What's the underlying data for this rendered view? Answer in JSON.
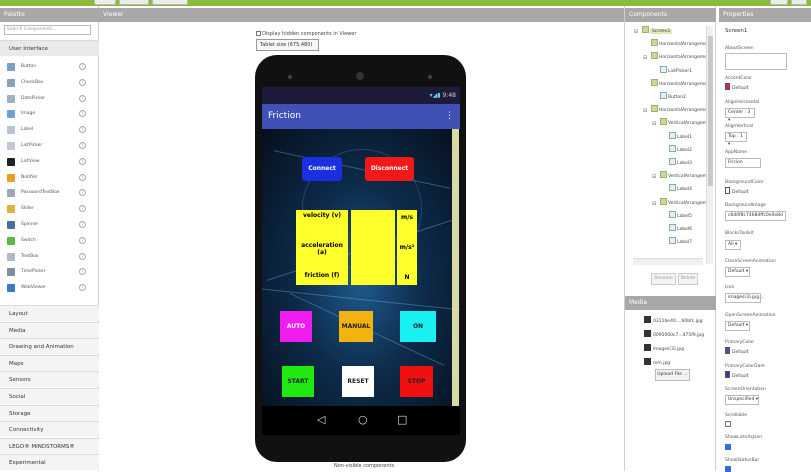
{
  "palette": {
    "title": "Palette",
    "search_placeholder": "Search Components...",
    "user_interface_label": "User Interface",
    "items": [
      {
        "label": "Button",
        "icon": "button-icon",
        "color": "#7a9fc8"
      },
      {
        "label": "CheckBox",
        "icon": "checkbox-icon",
        "color": "#8aa0b8"
      },
      {
        "label": "DatePicker",
        "icon": "datepicker-icon",
        "color": "#9db0c6"
      },
      {
        "label": "Image",
        "icon": "image-icon",
        "color": "#6ea0d0"
      },
      {
        "label": "Label",
        "icon": "label-icon",
        "color": "#b8c4d4"
      },
      {
        "label": "ListPicker",
        "icon": "listpicker-icon",
        "color": "#c0c8d4"
      },
      {
        "label": "ListView",
        "icon": "listview-icon",
        "color": "#222222"
      },
      {
        "label": "Notifier",
        "icon": "notifier-icon",
        "color": "#e8a020"
      },
      {
        "label": "PasswordTextBox",
        "icon": "password-icon",
        "color": "#9aa8b8"
      },
      {
        "label": "Slider",
        "icon": "slider-icon",
        "color": "#e0b040"
      },
      {
        "label": "Spinner",
        "icon": "spinner-icon",
        "color": "#4a6fa0"
      },
      {
        "label": "Switch",
        "icon": "switch-icon",
        "color": "#58b848"
      },
      {
        "label": "TextBox",
        "icon": "textbox-icon",
        "color": "#b0b8c4"
      },
      {
        "label": "TimePicker",
        "icon": "timepicker-icon",
        "color": "#8090a4"
      },
      {
        "label": "WebViewer",
        "icon": "webviewer-icon",
        "color": "#3a78c8"
      }
    ],
    "categories": [
      "Layout",
      "Media",
      "Drawing and Animation",
      "Maps",
      "Sensors",
      "Social",
      "Storage",
      "Connectivity",
      "LEGO® MINDSTORMS®",
      "Experimental"
    ]
  },
  "viewer": {
    "title": "Viewer",
    "hidden_checkbox_label": "Display hidden components in Viewer",
    "size_select": "Tablet size (675,480)",
    "status_time": "9:48",
    "app_title": "Friction",
    "menu_glyph": "⋮",
    "buttons": {
      "connect": "Connect",
      "disconnect": "Disconnect",
      "auto": "AUTO",
      "manual": "MANUAL",
      "on": "ON",
      "start": "START",
      "reset": "RESET",
      "stop": "STOP"
    },
    "labels": {
      "velocity": "velocity (v)",
      "acceleration": "acceleration (a)",
      "friction": "friction (f)",
      "unit_v": "m/s",
      "unit_a": "m/s²",
      "unit_f": "N"
    },
    "nav": {
      "back": "◁",
      "home": "○",
      "recent": "□"
    },
    "non_visible": "Non-visible components"
  },
  "components": {
    "title": "Components",
    "tree": [
      {
        "label": "Screen1",
        "level": 0,
        "expander": "⊟",
        "icon": "screen-icon"
      },
      {
        "label": "HorizontalArrangeme",
        "level": 1,
        "expander": "",
        "icon": "arrangement-icon"
      },
      {
        "label": "HorizontalArrangeme",
        "level": 1,
        "expander": "⊟",
        "icon": "arrangement-icon"
      },
      {
        "label": "ListPicker1",
        "level": 2,
        "expander": "",
        "icon": "listpicker-icon"
      },
      {
        "label": "HorizontalArrangeme",
        "level": 1,
        "expander": "",
        "icon": "arrangement-icon"
      },
      {
        "label": "Button2",
        "level": 2,
        "expander": "",
        "icon": "button-icon"
      },
      {
        "label": "HorizontalArrangeme",
        "level": 1,
        "expander": "⊟",
        "icon": "arrangement-icon"
      },
      {
        "label": "VerticalArrangeme",
        "level": 2,
        "expander": "⊟",
        "icon": "arrangement-icon"
      },
      {
        "label": "Label1",
        "level": 3,
        "expander": "",
        "icon": "label-icon"
      },
      {
        "label": "Label2",
        "level": 3,
        "expander": "",
        "icon": "label-icon"
      },
      {
        "label": "Label3",
        "level": 3,
        "expander": "",
        "icon": "label-icon"
      },
      {
        "label": "VerticalArrangeme",
        "level": 2,
        "expander": "⊟",
        "icon": "arrangement-icon"
      },
      {
        "label": "Label4",
        "level": 3,
        "expander": "",
        "icon": "label-icon"
      },
      {
        "label": "VerticalArrangeme",
        "level": 2,
        "expander": "⊟",
        "icon": "arrangement-icon"
      },
      {
        "label": "Label5",
        "level": 3,
        "expander": "",
        "icon": "label-icon"
      },
      {
        "label": "Label6",
        "level": 3,
        "expander": "",
        "icon": "label-icon"
      },
      {
        "label": "Label7",
        "level": 3,
        "expander": "",
        "icon": "label-icon"
      }
    ],
    "rename": "Rename",
    "delete": "Delete"
  },
  "media": {
    "title": "Media",
    "files": [
      "0311be40....60bfc.jpg",
      "0095000c7...475f9.jpg",
      "images(3).jpg",
      "mm.jpg"
    ],
    "upload": "Upload File ..."
  },
  "properties": {
    "title": "Properties",
    "screen": "Screen1",
    "about_screen_label": "AboutScreen",
    "accent_label": "AccentColor",
    "accent_value": "Default",
    "accent_color": "#e8204a",
    "align_h_label": "AlignHorizontal",
    "align_h_value": "Center : 3 ▾",
    "align_v_label": "AlignVertical",
    "align_v_value": "Top : 1 ▾",
    "appname_label": "AppName",
    "appname_value": "Fricion",
    "bgcolor_label": "BackgroundColor",
    "bgcolor_value": "Default",
    "bgimage_label": "BackgroundImage",
    "bgimage_value": "c6d0f8c74684ffc0e0e8d",
    "blocks_label": "BlocksToolkit",
    "blocks_value": "All ▾",
    "close_anim_label": "CloseScreenAnimation",
    "close_anim_value": "Default ▾",
    "icon_label": "Icon",
    "icon_value": "images(3).jpg...",
    "open_anim_label": "OpenScreenAnimation",
    "open_anim_value": "Default ▾",
    "primary_label": "PrimaryColor",
    "primary_value": "Default",
    "primary_color": "#3f51b5",
    "primary_dark_label": "PrimaryColorDark",
    "primary_dark_value": "Default",
    "primary_dark_color": "#303f9f",
    "orientation_label": "ScreenOrientation",
    "orientation_value": "Unspecified ▾",
    "scrollable_label": "Scrollable",
    "show_json_label": "ShowListsAsJson",
    "show_status_label": "ShowStatusBar"
  }
}
